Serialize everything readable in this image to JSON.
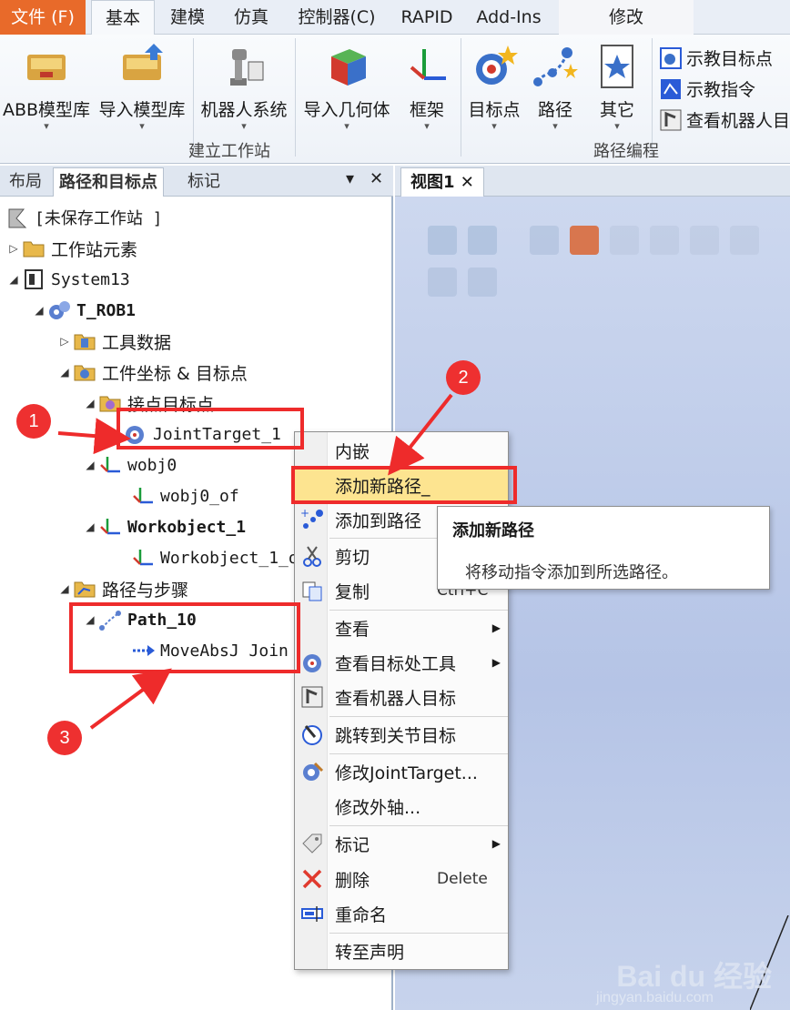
{
  "ribbon_tabs": [
    "文件 (F)",
    "基本",
    "建模",
    "仿真",
    "控制器(C)",
    "RAPID",
    "Add-Ins",
    "修改"
  ],
  "ribbon": {
    "build_station": {
      "label": "建立工作站",
      "buttons": [
        "ABB模型库",
        "导入模型库",
        "机器人系统",
        "导入几何体",
        "框架"
      ]
    },
    "path_programming": {
      "label": "路径编程",
      "buttons": [
        "目标点",
        "路径",
        "其它"
      ],
      "small_buttons": [
        "示教目标点",
        "示教指令",
        "查看机器人目"
      ]
    }
  },
  "panel": {
    "tabs": [
      "布局",
      "路径和目标点",
      "标记"
    ],
    "controls": [
      "▾",
      "✕"
    ]
  },
  "tree": {
    "station": "[未保存工作站 ]",
    "items": {
      "station_elements": "工作站元素",
      "system": "System13",
      "task": "T_ROB1",
      "tool_data": "工具数据",
      "wobj_targets": "工件坐标 & 目标点",
      "joint_targets": "接点目标点",
      "joint_target_1": "JointTarget_1",
      "wobj0": "wobj0",
      "wobj0_of": "wobj0_of",
      "workobject_1": "Workobject_1",
      "workobject_1_of": "Workobject_1_o",
      "paths_procedures": "路径与步骤",
      "path_10": "Path_10",
      "moveabsj": "MoveAbsJ Join"
    }
  },
  "view_tab": "视图1 ✕",
  "context_menu": {
    "items": [
      {
        "label": "内嵌"
      },
      {
        "label": "添加新路径_"
      },
      {
        "label": "添加到路径"
      },
      {
        "label": "剪切"
      },
      {
        "label": "复制",
        "shortcut": "Ctrl+C"
      },
      {
        "label": "查看"
      },
      {
        "label": "查看目标处工具"
      },
      {
        "label": "查看机器人目标"
      },
      {
        "label": "跳转到关节目标"
      },
      {
        "label": "修改JointTarget..."
      },
      {
        "label": "修改外轴..."
      },
      {
        "label": "标记"
      },
      {
        "label": "删除",
        "shortcut": "Delete"
      },
      {
        "label": "重命名"
      },
      {
        "label": "转至声明"
      }
    ]
  },
  "tooltip": {
    "title": "添加新路径",
    "text": "将移动指令添加到所选路径。"
  },
  "annotations": [
    "1",
    "2",
    "3"
  ],
  "watermark": {
    "logo": "Bai du 经验",
    "url": "jingyan.baidu.com"
  },
  "colors": {
    "accent": "#ee2b2b",
    "file_tab": "#e86a2a",
    "highlight": "#fde490"
  }
}
